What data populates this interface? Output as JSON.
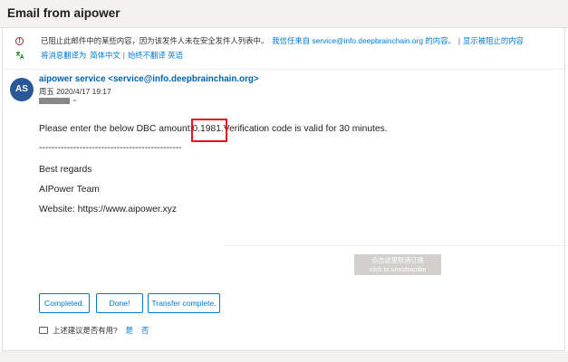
{
  "header": {
    "title": "Email from aipower"
  },
  "info": {
    "blocked_text": "已阻止此邮件中的某些内容，因为该发件人未在安全发件人列表中。",
    "trust_link": "我信任来自 service@info.deepbrainchain.org 的内容。",
    "separator": "|",
    "show_blocked_link": "显示被阻止的内容",
    "translate_prefix": "将消息翻译为",
    "translate_lang": "简体中文",
    "never_translate": "始终不翻译 英语"
  },
  "message": {
    "avatar_initials": "AS",
    "sender": "aipower service <service@info.deepbrainchain.org>",
    "date": "周五 2020/4/17 19:17",
    "body": {
      "line1_prefix": "Please enter the below DBC amount",
      "amount": ":0.1981.",
      "line1_suffix": "Verification code is valid for 30 minutes.",
      "dashes": "----------------------------------------------",
      "regards": "Best regards",
      "team": "AIPower Team",
      "website": "Website: https://www.aipower.xyz"
    },
    "unsubscribe": {
      "line1": "点击这里取消订阅",
      "line2": "click to unsubscribe"
    }
  },
  "actions": {
    "completed": "Completed.",
    "done": "Done!",
    "transfer": "Transfer complete."
  },
  "feedback": {
    "question": "上述建议是否有用?",
    "yes": "是",
    "no": "否"
  },
  "colors": {
    "accent": "#0078d4",
    "avatar": "#2b5797",
    "highlight": "#e81123",
    "warning": "#a4262c"
  }
}
